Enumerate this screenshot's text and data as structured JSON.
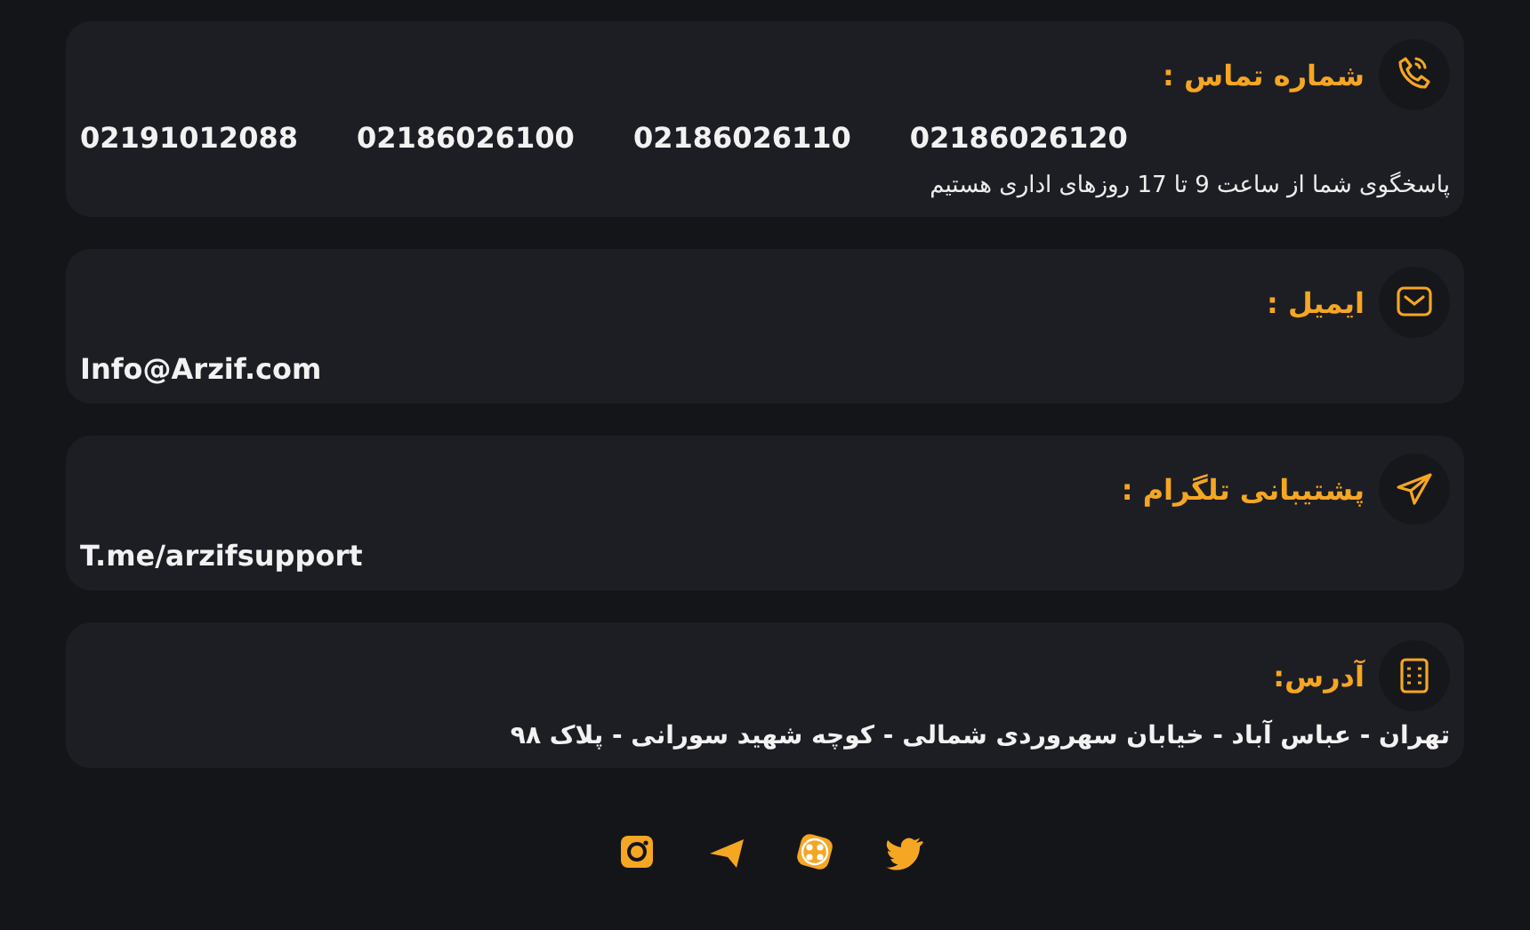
{
  "contacts": [
    {
      "kind": "phone",
      "title": "شماره تماس :",
      "values": [
        "02186026120",
        "02186026110",
        "02186026100",
        "02191012088"
      ],
      "note": "پاسخگوی شما از ساعت 9 تا 17 روزهای اداری هستیم"
    },
    {
      "kind": "email",
      "title": "ایمیل :",
      "values": [
        "Info@Arzif.com"
      ]
    },
    {
      "kind": "telegram",
      "title": "پشتیبانی تلگرام :",
      "values": [
        "T.me/arzifsupport"
      ]
    },
    {
      "kind": "address",
      "title": "آدرس:",
      "values": [
        "تهران - عباس آباد - خیابان سهروردی شمالی - کوچه شهید سورانی - پلاک ۹۸"
      ]
    }
  ],
  "socials": [
    {
      "kind": "instagram"
    },
    {
      "kind": "telegram"
    },
    {
      "kind": "aparat"
    },
    {
      "kind": "twitter"
    }
  ]
}
